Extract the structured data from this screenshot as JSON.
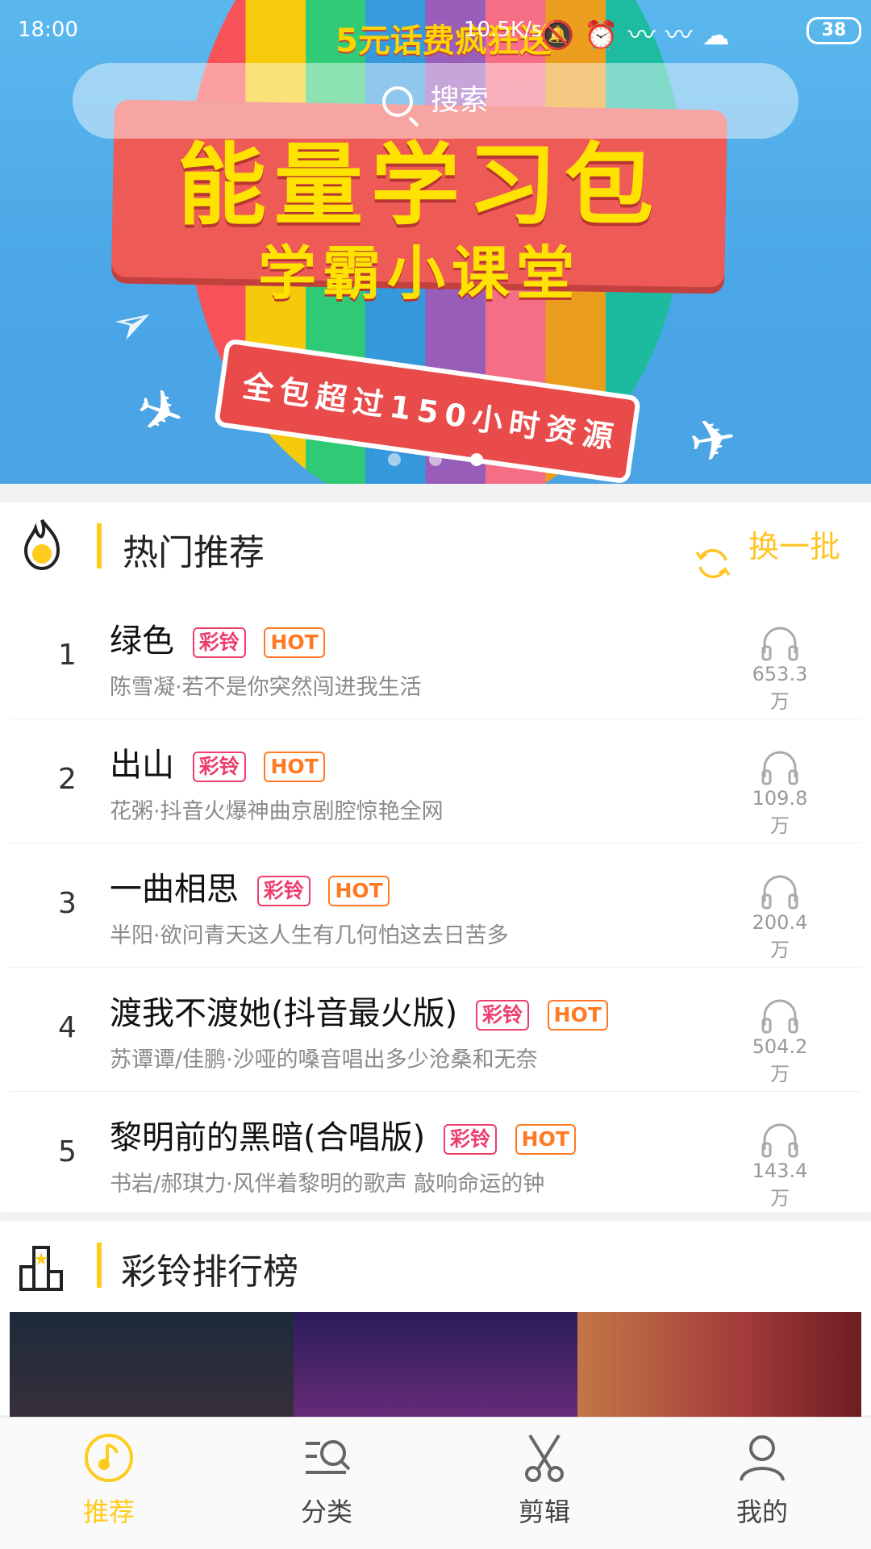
{
  "status_bar": {
    "time": "18:00",
    "network_speed": "10.5K/s",
    "battery": "38",
    "icons": [
      "mute-icon",
      "alarm-icon",
      "signal-icon",
      "hd-signal-icon",
      "wifi-icon"
    ]
  },
  "search": {
    "placeholder": "搜索"
  },
  "banner": {
    "top_text": "5元话费疯狂送",
    "title": "能量学习包",
    "subtitle": "学霸小课堂",
    "slogan": "全包超过150小时资源",
    "dots_count": 3,
    "active_dot": 3
  },
  "hot": {
    "title": "热门推荐",
    "refresh_label": "换一批",
    "accent_color": "#ffcc1d",
    "items": [
      {
        "rank": "1",
        "title": "绿色",
        "tags": [
          "彩铃",
          "HOT"
        ],
        "subtitle": "陈雪凝·若不是你突然闯进我生活",
        "plays": "653.3万"
      },
      {
        "rank": "2",
        "title": "出山",
        "tags": [
          "彩铃",
          "HOT"
        ],
        "subtitle": "花粥·抖音火爆神曲京剧腔惊艳全网",
        "plays": "109.8万"
      },
      {
        "rank": "3",
        "title": "一曲相思",
        "tags": [
          "彩铃",
          "HOT"
        ],
        "subtitle": "半阳·欲问青天这人生有几何怕这去日苦多",
        "plays": "200.4万"
      },
      {
        "rank": "4",
        "title": "渡我不渡她(抖音最火版)",
        "tags": [
          "彩铃",
          "HOT"
        ],
        "subtitle": "苏谭谭/佳鹏·沙哑的嗓音唱出多少沧桑和无奈",
        "plays": "504.2万"
      },
      {
        "rank": "5",
        "title": "黎明前的黑暗(合唱版)",
        "tags": [
          "彩铃",
          "HOT"
        ],
        "subtitle": "书岩/郝琪力·风伴着黎明的歌声 敲响命运的钟",
        "plays": "143.4万"
      }
    ]
  },
  "ranking": {
    "title": "彩铃排行榜"
  },
  "nav": {
    "items": [
      {
        "label": "推荐",
        "icon": "music-disc-icon",
        "active": true
      },
      {
        "label": "分类",
        "icon": "category-search-icon",
        "active": false
      },
      {
        "label": "剪辑",
        "icon": "scissors-icon",
        "active": false
      },
      {
        "label": "我的",
        "icon": "user-icon",
        "active": false
      }
    ]
  }
}
